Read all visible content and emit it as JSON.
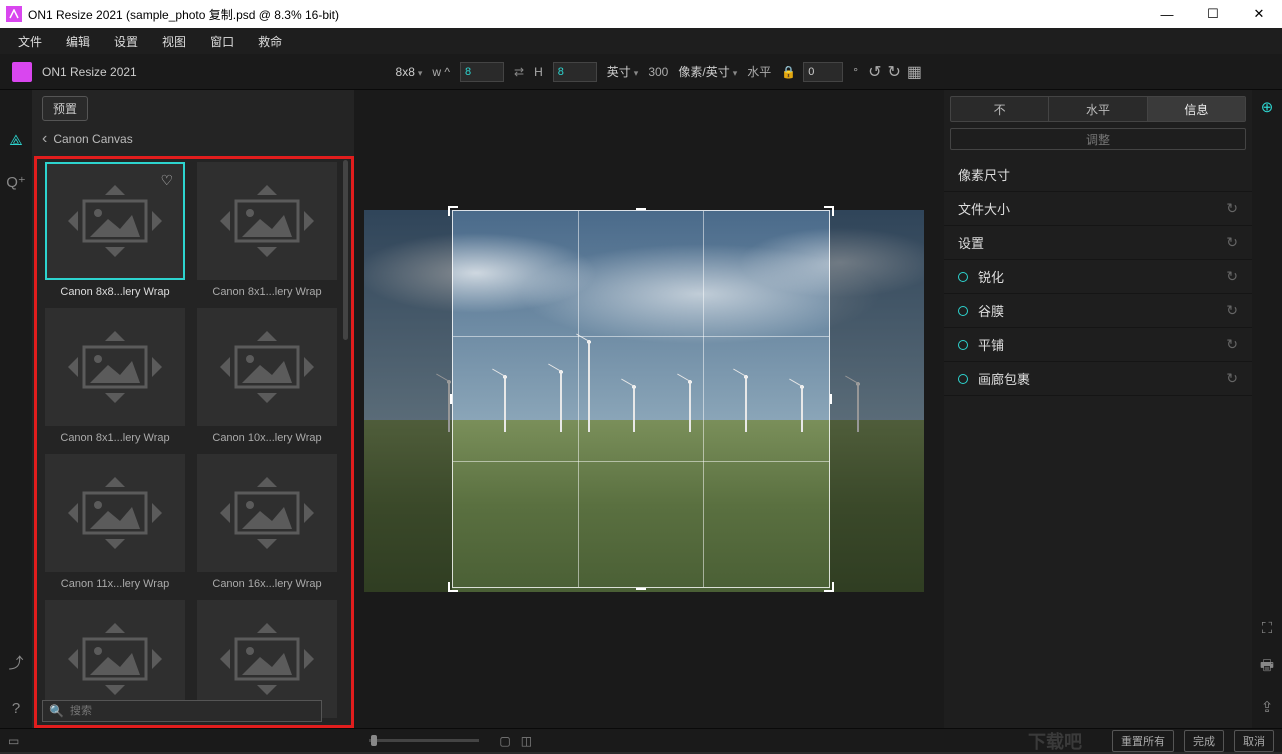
{
  "window": {
    "title": "ON1 Resize 2021 (sample_photo 复制.psd @ 8.3% 16-bit)"
  },
  "menu": [
    "文件",
    "编辑",
    "设置",
    "视图",
    "窗口",
    "救命"
  ],
  "app_name": "ON1 Resize 2021",
  "toolbar": {
    "ratio": "8x8",
    "w_label": "w",
    "w_value": "8",
    "h_label": "H",
    "h_value": "8",
    "unit": "英寸",
    "resolution": "300",
    "res_unit": "像素/英寸",
    "level_label": "水平",
    "level_value": "0",
    "degree": "°"
  },
  "preset": {
    "button": "预置",
    "breadcrumb": "Canon Canvas",
    "items": [
      {
        "label": "Canon 8x8...lery Wrap",
        "selected": true,
        "fav": true
      },
      {
        "label": "Canon 8x1...lery Wrap"
      },
      {
        "label": "Canon 8x1...lery Wrap"
      },
      {
        "label": "Canon 10x...lery Wrap"
      },
      {
        "label": "Canon 11x...lery Wrap"
      },
      {
        "label": "Canon 16x...lery Wrap"
      },
      {
        "label": ""
      },
      {
        "label": ""
      }
    ],
    "search_placeholder": "搜索"
  },
  "right": {
    "tabs": [
      "不",
      "水平",
      "信息"
    ],
    "active_tab": 2,
    "adjust": "调整",
    "sections": [
      {
        "label": "像素尺寸",
        "type": "main"
      },
      {
        "label": "文件大小",
        "type": "main",
        "reset": true
      },
      {
        "label": "设置",
        "type": "main",
        "reset": true
      },
      {
        "label": "锐化",
        "type": "sub",
        "reset": true
      },
      {
        "label": "谷膜",
        "type": "sub",
        "reset": true
      },
      {
        "label": "平铺",
        "type": "sub",
        "reset": true
      },
      {
        "label": "画廊包裹",
        "type": "sub",
        "reset": true
      }
    ]
  },
  "bottom": {
    "reset_all": "重置所有",
    "done": "完成",
    "cancel": "取消",
    "watermark": "下载吧"
  }
}
